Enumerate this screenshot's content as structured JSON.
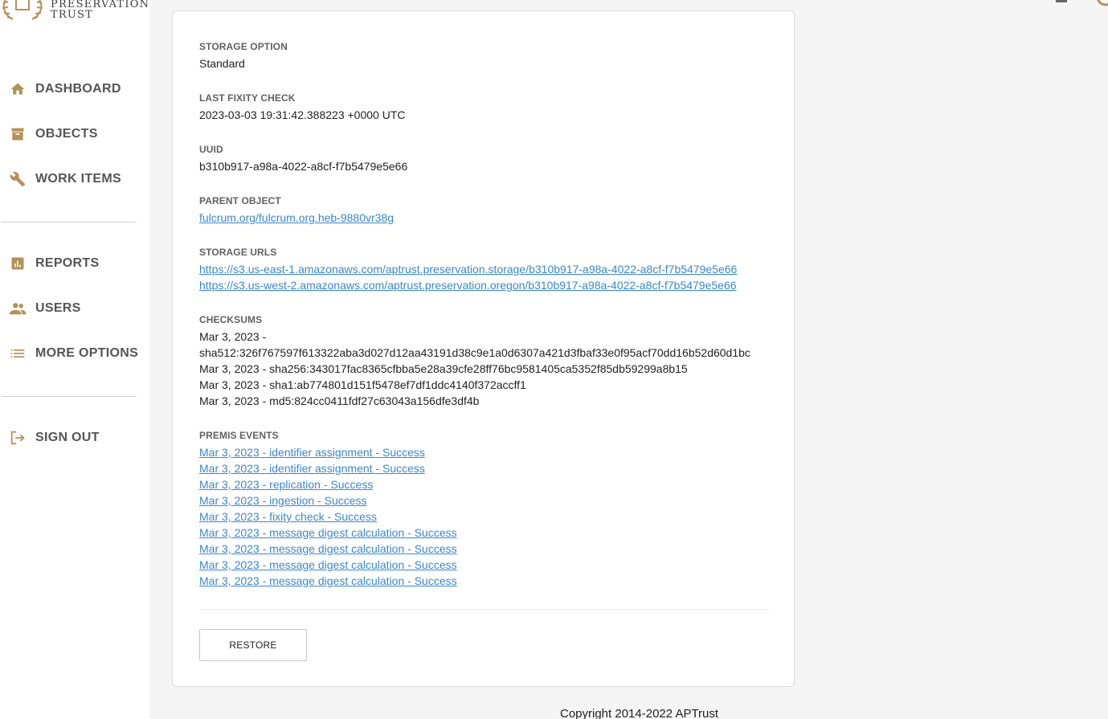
{
  "brand": {
    "line1": "PRESERVATION",
    "line2": "TRUST",
    "accent_color": "#b5915a"
  },
  "nav": {
    "primary": [
      {
        "label": "DASHBOARD",
        "icon": "home-icon"
      },
      {
        "label": "OBJECTS",
        "icon": "archive-box-icon"
      },
      {
        "label": "WORK ITEMS",
        "icon": "wrench-icon"
      }
    ],
    "secondary": [
      {
        "label": "REPORTS",
        "icon": "bar-chart-icon"
      },
      {
        "label": "USERS",
        "icon": "people-icon"
      },
      {
        "label": "MORE OPTIONS",
        "icon": "list-icon"
      }
    ],
    "signout": {
      "label": "SIGN OUT",
      "icon": "logout-icon"
    }
  },
  "file": {
    "storage_option": {
      "label": "STORAGE OPTION",
      "value": "Standard"
    },
    "last_fixity": {
      "label": "LAST FIXITY CHECK",
      "value": "2023-03-03 19:31:42.388223 +0000 UTC"
    },
    "uuid": {
      "label": "UUID",
      "value": "b310b917-a98a-4022-a8cf-f7b5479e5e66"
    },
    "parent_object": {
      "label": "PARENT OBJECT",
      "value": "fulcrum.org/fulcrum.org.heb-9880vr38g"
    },
    "storage_urls": {
      "label": "STORAGE URLS",
      "items": [
        "https://s3.us-east-1.amazonaws.com/aptrust.preservation.storage/b310b917-a98a-4022-a8cf-f7b5479e5e66",
        "https://s3.us-west-2.amazonaws.com/aptrust.preservation.oregon/b310b917-a98a-4022-a8cf-f7b5479e5e66"
      ]
    },
    "checksums": {
      "label": "CHECKSUMS",
      "lines": [
        "Mar 3, 2023 -",
        "sha512:326f767597f613322aba3d027d12aa43191d38c9e1a0d6307a421d3fbaf33e0f95acf70dd16b52d60d1bc",
        "Mar 3, 2023 - sha256:343017fac8365cfbba5e28a39cfe28ff76bc9581405ca5352f85db59299a8b15",
        "Mar 3, 2023 - sha1:ab774801d151f5478ef7df1ddc4140f372accff1",
        "Mar 3, 2023 - md5:824cc0411fdf27c63043a156dfe3df4b"
      ]
    },
    "premis_events": {
      "label": "PREMIS EVENTS",
      "items": [
        "Mar 3, 2023 - identifier assignment - Success",
        "Mar 3, 2023 - identifier assignment - Success",
        "Mar 3, 2023 - replication - Success",
        "Mar 3, 2023 - ingestion - Success",
        "Mar 3, 2023 - fixity check - Success",
        "Mar 3, 2023 - message digest calculation - Success",
        "Mar 3, 2023 - message digest calculation - Success",
        "Mar 3, 2023 - message digest calculation - Success",
        "Mar 3, 2023 - message digest calculation - Success"
      ]
    }
  },
  "actions": {
    "restore_label": "RESTORE"
  },
  "footer": {
    "copyright": "Copyright 2014-2022 APTrust"
  },
  "colors": {
    "link": "#3b87cf",
    "icon": "#b5915a",
    "nav_text": "#555555"
  }
}
